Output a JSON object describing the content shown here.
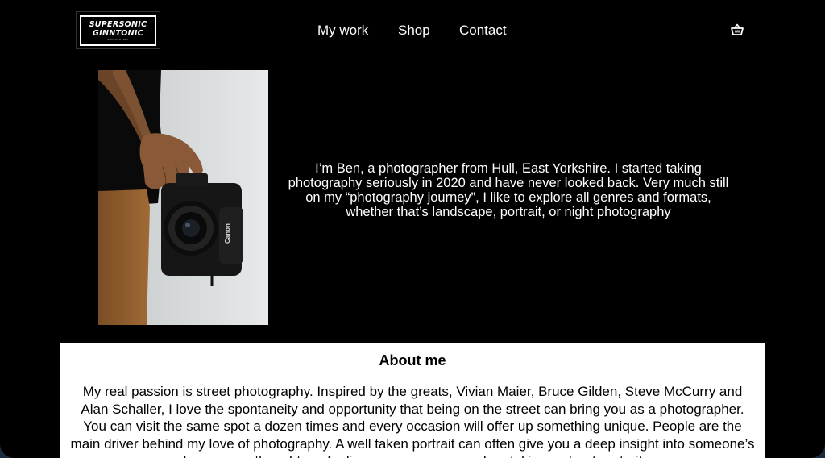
{
  "header": {
    "logo": {
      "line1": "SUPERSONIC",
      "line2": "GINNTONIC",
      "line3": "PHOTOGRAPHY"
    },
    "nav": [
      {
        "label": "My work"
      },
      {
        "label": "Shop"
      },
      {
        "label": "Contact"
      }
    ],
    "cart_icon": "basket-icon"
  },
  "hero": {
    "image": "photographer-holding-camera",
    "intro": "I’m Ben, a photographer from Hull, East Yorkshire. I started taking photography seriously in 2020 and have never looked back. Very much still on my “photography journey”, I like to explore all genres and formats, whether that’s landscape, portrait, or night photography"
  },
  "about": {
    "heading": "About me",
    "body": "My real passion is street photography. Inspired by the greats, Vivian Maier, Bruce Gilden, Steve McCurry and Alan Schaller, I love the spontaneity and opportunity that being on the street can bring you as a photographer. You can visit the same spot a dozen times and every occasion will offer up something unique. People are the main driver behind my love of photography. A well taken portrait can often give you a deep insight into someone’s demeanour, thoughts or feelings - even more so when taking a street portrait."
  },
  "colors": {
    "page_bg": "#000000",
    "text": "#ffffff",
    "panel_bg": "#ffffff",
    "outer_bg": "#1b2a3d"
  }
}
